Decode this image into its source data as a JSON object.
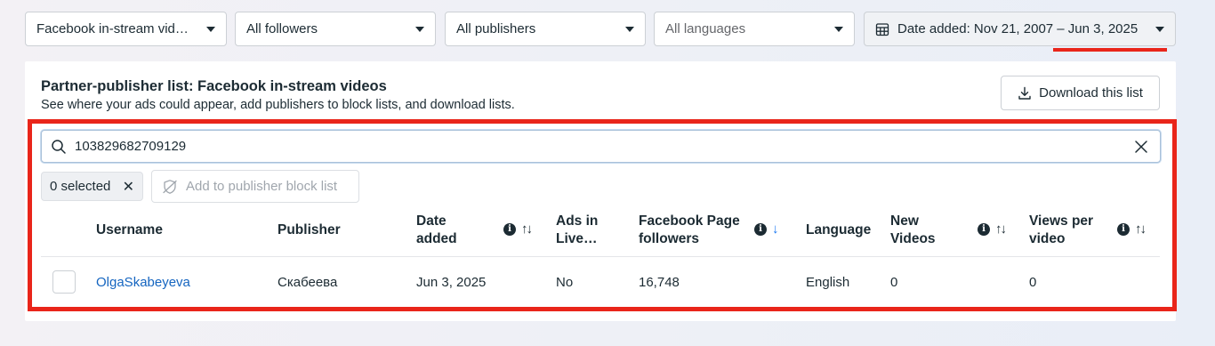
{
  "filters": {
    "placement": "Facebook in-stream vid…",
    "followers": "All followers",
    "publishers": "All publishers",
    "languages": "All languages",
    "date_range": "Date added: Nov 21, 2007 – Jun 3, 2025"
  },
  "card": {
    "title": "Partner-publisher list: Facebook in-stream videos",
    "subtitle": "See where your ads could appear, add publishers to block lists, and download lists.",
    "download_label": "Download this list"
  },
  "search": {
    "value": "103829682709129"
  },
  "selection": {
    "selected_label": "0 selected",
    "block_button_label": "Add to publisher block list"
  },
  "table": {
    "columns": {
      "username": "Username",
      "publisher": "Publisher",
      "date_added_line1": "Date",
      "date_added_line2": "added",
      "ads_in_live_line1": "Ads in",
      "ads_in_live_line2": "Live…",
      "fb_followers_line1": "Facebook Page",
      "fb_followers_line2": "followers",
      "language": "Language",
      "new_videos_line1": "New",
      "new_videos_line2": "Videos",
      "views_line1": "Views per",
      "views_line2": "video"
    },
    "rows": [
      {
        "username": "OlgaSkabeyeva",
        "publisher": "Скабеева",
        "date_added": "Jun 3, 2025",
        "ads_in_live": "No",
        "followers": "16,748",
        "language": "English",
        "new_videos": "0",
        "views_per_video": "0"
      }
    ]
  },
  "colors": {
    "highlight": "#e9251a",
    "link": "#1565c0",
    "sort_active": "#1877f2"
  }
}
